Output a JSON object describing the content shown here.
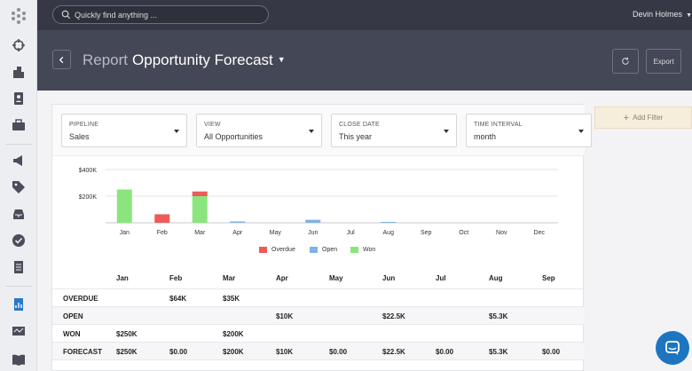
{
  "search": {
    "placeholder": "Quickly find anything ..."
  },
  "user": {
    "name": "Devin Holmes"
  },
  "header": {
    "prefix": "Report",
    "title": "Opportunity Forecast",
    "export_label": "Export"
  },
  "add_filter_label": "Add Filter",
  "filters": [
    {
      "label": "PIPELINE",
      "value": "Sales"
    },
    {
      "label": "VIEW",
      "value": "All Opportunities"
    },
    {
      "label": "CLOSE DATE",
      "value": "This year"
    },
    {
      "label": "TIME INTERVAL",
      "value": "month"
    }
  ],
  "chart_data": {
    "type": "bar",
    "stacked": true,
    "categories": [
      "Jan",
      "Feb",
      "Mar",
      "Apr",
      "May",
      "Jun",
      "Jul",
      "Aug",
      "Sep",
      "Oct",
      "Nov",
      "Dec"
    ],
    "y_ticks": [
      "$400K",
      "$200K"
    ],
    "ylim": [
      0,
      400000
    ],
    "series": [
      {
        "name": "Won",
        "color": "#8ae57d",
        "values": [
          250000,
          0,
          200000,
          0,
          0,
          0,
          0,
          0,
          0,
          0,
          0,
          0
        ]
      },
      {
        "name": "Open",
        "color": "#7fb2e6",
        "values": [
          0,
          0,
          0,
          10000,
          0,
          22500,
          0,
          5300,
          0,
          0,
          0,
          0
        ]
      },
      {
        "name": "Overdue",
        "color": "#ee5a5a",
        "values": [
          0,
          64000,
          35000,
          0,
          0,
          0,
          0,
          0,
          0,
          0,
          0,
          0
        ]
      }
    ],
    "legend": [
      "Overdue",
      "Open",
      "Won"
    ],
    "grid": true,
    "legend_position": "bottom"
  },
  "table": {
    "columns": [
      "Jan",
      "Feb",
      "Mar",
      "Apr",
      "May",
      "Jun",
      "Jul",
      "Aug",
      "Sep"
    ],
    "rows": [
      {
        "label": "OVERDUE",
        "cells": [
          "",
          "$64K",
          "$35K",
          "",
          "",
          "",
          "",
          "",
          ""
        ]
      },
      {
        "label": "OPEN",
        "cells": [
          "",
          "",
          "",
          "$10K",
          "",
          "$22.5K",
          "",
          "$5.3K",
          ""
        ]
      },
      {
        "label": "WON",
        "cells": [
          "$250K",
          "",
          "$200K",
          "",
          "",
          "",
          "",
          "",
          ""
        ]
      },
      {
        "label": "FORECAST",
        "cells": [
          "$250K",
          "$0.00",
          "$200K",
          "$10K",
          "$0.00",
          "$22.5K",
          "$0.00",
          "$5.3K",
          "$0.00"
        ]
      }
    ]
  },
  "icons": {
    "sidebar": [
      "logo-icon",
      "crosshair-icon",
      "building-icon",
      "contact-icon",
      "briefcase-icon",
      "megaphone-icon",
      "tag-icon",
      "inbox-icon",
      "check-circle-icon",
      "document-icon",
      "report-icon",
      "activity-icon",
      "book-icon"
    ],
    "chat": "chat-bubble-icon"
  }
}
